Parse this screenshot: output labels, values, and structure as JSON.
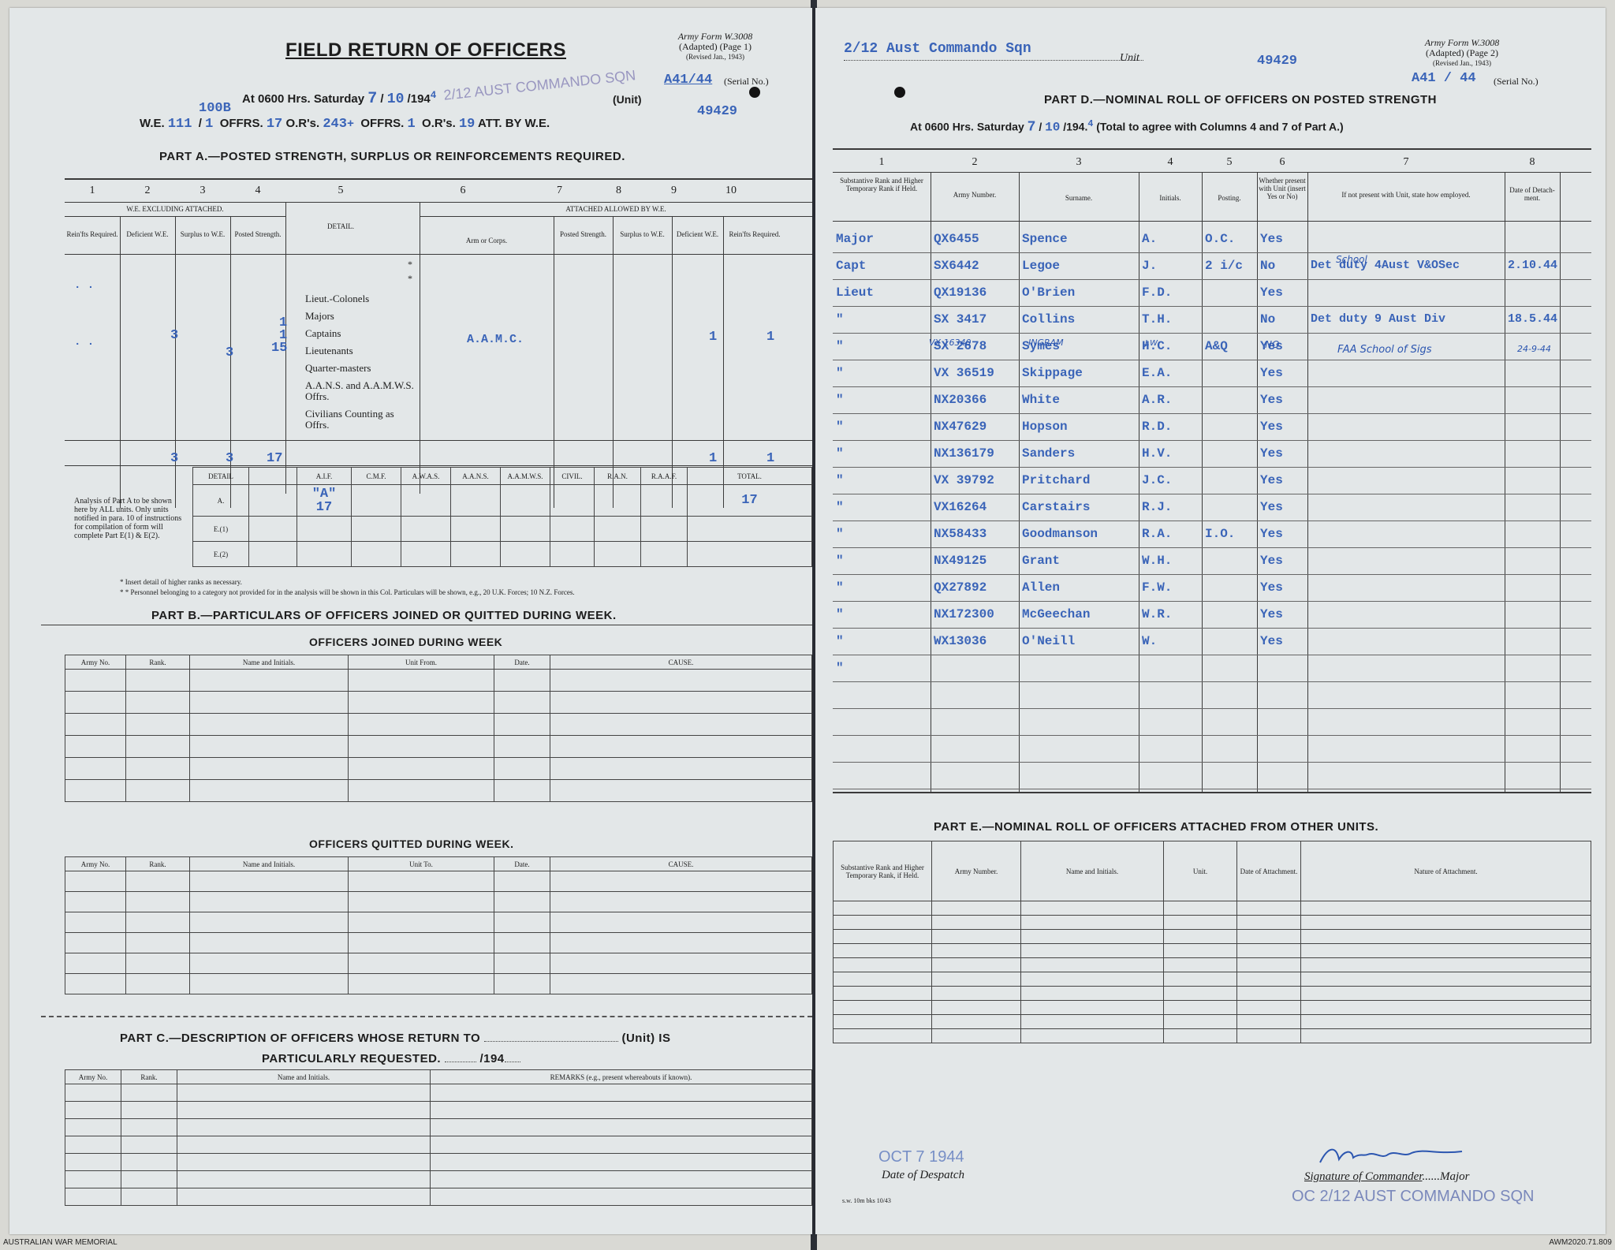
{
  "left": {
    "form_ref": "Army Form W.3008",
    "form_adapted": "(Adapted) (Page 1)",
    "form_revised": "(Revised Jan., 1943)",
    "title": "FIELD RETURN OF OFFICERS",
    "at_line": "At 0600 Hrs. Saturday",
    "date_day": "7",
    "date_month": "10",
    "date_year_prefix": "194",
    "date_year_suffix": "4",
    "unit_label": "(Unit)",
    "serial_value": "A41/44",
    "serial_label": "(Serial No.)",
    "stamp_unit": "2/12 AUST COMMANDO SQN",
    "we_label": "W.E.",
    "we_value": "111",
    "we_sup": "100B",
    "we_slash": "1",
    "offrs_label": "OFFRS.",
    "offrs_value": "17",
    "ors_label": "O.R's.",
    "ors_value": "243",
    "plus": "+",
    "offrs2_value": "1",
    "ors2_value": "19",
    "att_label": "ATT. BY W.E.",
    "unit_code": "49429",
    "part_a_title": "PART A.—POSTED STRENGTH, SURPLUS OR REINFORCEMENTS REQUIRED.",
    "col_numbers": [
      "1",
      "2",
      "3",
      "4",
      "5",
      "6",
      "7",
      "8",
      "9",
      "10"
    ],
    "we_excl": "W.E. EXCLUDING ATTACHED.",
    "attached_allowed": "ATTACHED ALLOWED BY W.E.",
    "col_heads": [
      "Rein'fts Required.",
      "Deficient W.E.",
      "Surplus to W.E.",
      "Posted Strength.",
      "DETAIL.",
      "Arm or Corps.",
      "Posted Strength.",
      "Surplus to W.E.",
      "Deficient W.E.",
      "Rein'fts Required."
    ],
    "ranks": [
      "Lieut.-Colonels",
      "Majors",
      "Captains",
      "Lieutenants",
      "Quarter-masters",
      "A.A.N.S. and A.A.M.W.S. Offrs.",
      "Civilians Counting as Offrs."
    ],
    "star": "*",
    "dots1": ". .",
    "deficient_val": "3",
    "surplus_val": "3",
    "posted_vals": [
      "1",
      "1",
      "15"
    ],
    "corps_val": "A.A.M.C.",
    "att_deficient": "1",
    "att_reinf": "1",
    "totals": {
      "deficient": "3",
      "surplus": "3",
      "posted": "17",
      "att_deficient": "1",
      "att_reinf": "1"
    },
    "analysis_note": "Analysis of Part A to be shown here by ALL units. Only units notified in para. 10 of instructions for compilation of form will complete Part E(1) & E(2).",
    "analysis_heads": [
      "DETAIL",
      "A.I.F.",
      "C.M.F.",
      "A.W.A.S.",
      "A.A.N.S.",
      "A.A.M.W.S.",
      "CIVIL.",
      "R.A.N.",
      "R.A.A.F.",
      "TOTAL."
    ],
    "analysis_rows": [
      "A.",
      "E.(1)",
      "E.(2)"
    ],
    "aif_a_label": "\"A\"",
    "aif_a_value": "17",
    "total_a_value": "17",
    "note1": "* Insert detail of higher ranks as necessary.",
    "note2": "* * Personnel belonging to a category not provided for in the analysis will be shown in this Col. Particulars will be shown, e.g., 20 U.K. Forces; 10 N.Z. Forces.",
    "part_b_title": "PART B.—PARTICULARS OF OFFICERS JOINED OR QUITTED DURING WEEK.",
    "joined_title": "OFFICERS JOINED DURING WEEK",
    "joined_heads": [
      "Army No.",
      "Rank.",
      "Name and Initials.",
      "Unit From.",
      "Date.",
      "CAUSE."
    ],
    "quitted_title": "OFFICERS QUITTED DURING WEEK.",
    "quitted_heads": [
      "Army No.",
      "Rank.",
      "Name and Initials.",
      "Unit To.",
      "Date.",
      "CAUSE."
    ],
    "part_c_title": "PART C.—DESCRIPTION OF OFFICERS WHOSE RETURN TO",
    "part_c_unit": "(Unit) IS",
    "part_c_line2": "PARTICULARLY REQUESTED.",
    "part_c_date": "/194",
    "part_c_heads": [
      "Army No.",
      "Rank.",
      "Name and Initials.",
      "REMARKS (e.g., present whereabouts if known)."
    ]
  },
  "right": {
    "unit_name": "2/12 Aust Commando Sqn",
    "unit_label": "Unit",
    "unit_code": "49429",
    "form_ref": "Army Form W.3008",
    "form_adapted": "(Adapted) (Page 2)",
    "form_revised": "(Revised Jan., 1943)",
    "serial_value": "A41 / 44",
    "serial_label": "(Serial No.)",
    "part_d_title": "PART D.—NOMINAL ROLL OF OFFICERS ON POSTED STRENGTH",
    "at_line": "At 0600 Hrs. Saturday",
    "date_day": "7",
    "date_month": "10",
    "date_year_prefix": "194.",
    "date_year_suffix": "4",
    "total_note": "(Total to agree with Columns 4 and 7 of Part A.)",
    "col_numbers": [
      "1",
      "2",
      "3",
      "4",
      "5",
      "6",
      "7",
      "8"
    ],
    "col_heads": [
      "Substantive Rank and Higher Temporary Rank if Held.",
      "Army Number.",
      "Surname.",
      "Initials.",
      "Posting.",
      "Whether present with Unit (insert Yes or No)",
      "If not present with Unit, state how employed.",
      "Date of Detach-ment."
    ],
    "officers": [
      {
        "rank": "Major",
        "army": "QX6455",
        "surname": "Spence",
        "init": "A.",
        "post": "O.C.",
        "present": "Yes",
        "how": "",
        "date": ""
      },
      {
        "rank": "Capt",
        "army": "SX6442",
        "surname": "Legoe",
        "init": "J.",
        "post": "2 i/c",
        "present": "No",
        "how": "Det duty 4Aust V&OSec",
        "date": "2.10.44"
      },
      {
        "rank": "Lieut",
        "army": "QX19136",
        "surname": "O'Brien",
        "init": "F.D.",
        "post": "",
        "present": "Yes",
        "how": "",
        "date": ""
      },
      {
        "rank": "\"",
        "army": "SX 3417",
        "surname": "Collins",
        "init": "T.H.",
        "post": "",
        "present": "No",
        "how": "Det duty 9 Aust Div",
        "date": "18.5.44"
      },
      {
        "rank": "\"",
        "army": "SX 2678",
        "surname": "Symes",
        "init": "H.C.",
        "post": "A&Q",
        "present": "Yes",
        "how": "",
        "date": ""
      },
      {
        "rank": "\"",
        "army": "VX 36519",
        "surname": "Skippage",
        "init": "E.A.",
        "post": "",
        "present": "Yes",
        "how": "",
        "date": ""
      },
      {
        "rank": "\"",
        "army": "NX20366",
        "surname": "White",
        "init": "A.R.",
        "post": "",
        "present": "Yes",
        "how": "",
        "date": ""
      },
      {
        "rank": "\"",
        "army": "NX47629",
        "surname": "Hopson",
        "init": "R.D.",
        "post": "",
        "present": "Yes",
        "how": "",
        "date": ""
      },
      {
        "rank": "\"",
        "army": "NX136179",
        "surname": "Sanders",
        "init": "H.V.",
        "post": "",
        "present": "Yes",
        "how": "",
        "date": ""
      },
      {
        "rank": "\"",
        "army": "VX 39792",
        "surname": "Pritchard",
        "init": "J.C.",
        "post": "",
        "present": "Yes",
        "how": "",
        "date": ""
      },
      {
        "rank": "\"",
        "army": "VX16264",
        "surname": "Carstairs",
        "init": "R.J.",
        "post": "",
        "present": "Yes",
        "how": "",
        "date": ""
      },
      {
        "rank": "\"",
        "army": "NX58433",
        "surname": "Goodmanson",
        "init": "R.A.",
        "post": "I.O.",
        "present": "Yes",
        "how": "",
        "date": ""
      },
      {
        "rank": "\"",
        "army": "NX49125",
        "surname": "Grant",
        "init": "W.H.",
        "post": "",
        "present": "Yes",
        "how": "",
        "date": ""
      },
      {
        "rank": "\"",
        "army": "QX27892",
        "surname": "Allen",
        "init": "F.W.",
        "post": "",
        "present": "Yes",
        "how": "",
        "date": ""
      },
      {
        "rank": "\"",
        "army": "NX172300",
        "surname": "McGeechan",
        "init": "W.R.",
        "post": "",
        "present": "Yes",
        "how": "",
        "date": ""
      },
      {
        "rank": "\"",
        "army": "WX13036",
        "surname": "O'Neill",
        "init": "W.",
        "post": "",
        "present": "Yes",
        "how": "",
        "date": ""
      },
      {
        "rank": "\"",
        "army": "",
        "surname": "",
        "init": "",
        "post": "",
        "present": "",
        "how": "",
        "date": ""
      }
    ],
    "hw_school": "School",
    "hw_ingram_no": "VX 16340",
    "hw_ingram": "INGRAM",
    "hw_ingram_init": "J.W.",
    "hw_no": "NO",
    "hw_faa": "FAA School of Sigs",
    "hw_faa_date": "24-9-44",
    "part_e_title": "PART E.—NOMINAL ROLL OF OFFICERS ATTACHED FROM OTHER UNITS.",
    "part_e_heads": [
      "Substantive Rank and Higher Temporary Rank, if Held.",
      "Army Number.",
      "Name and Initials.",
      "Unit.",
      "Date of Attachment.",
      "Nature of Attachment."
    ],
    "despatch_date": "OCT 7 1944",
    "despatch_label": "Date of Despatch",
    "signature_label": "Signature of Commander",
    "signature_rank": "Major",
    "stamp_oc": "OC 2/12 AUST COMMANDO SQN",
    "print_ref": "s.w. 10m bks 10/43"
  },
  "footer": {
    "left": "AUSTRALIAN WAR MEMORIAL",
    "right": "AWM2020.71.809"
  }
}
